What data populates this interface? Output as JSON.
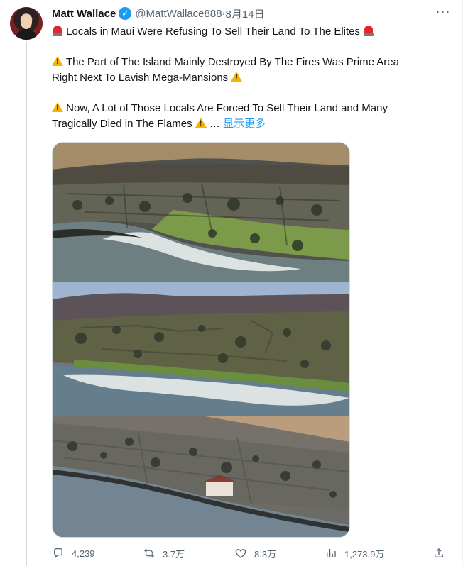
{
  "tweet": {
    "author_name": "Matt Wallace",
    "handle": "@MattWallace888",
    "separator": "·",
    "date": "8月14日",
    "more_label": "···",
    "text_lines": {
      "p1": "Locals in Maui Were Refusing To Sell Their Land To The Elites",
      "p2a": "The Part of The Island Mainly Destroyed By The Fires Was Prime Area",
      "p2b": "Right Next To Lavish Mega-Mansions",
      "p3a": "Now, A Lot of Those Locals Are Forced To Sell Their Land and Many",
      "p3b": "Tragically Died in The Flames",
      "ellipsis": " … ",
      "show_more": "显示更多"
    },
    "verified_mark": "✓",
    "icons": [
      "siren-emoji",
      "warning-emoji"
    ],
    "accent_color": "#1d9bf0"
  },
  "media": {
    "images": [
      "aerial-photo-burned-coastline-1",
      "aerial-photo-burned-coastline-2",
      "aerial-photo-burned-coastline-3"
    ]
  },
  "actions": {
    "reply_count": "4,239",
    "retweet_count": "3.7万",
    "like_count": "8.3万",
    "views_count": "1,273.9万",
    "icons": [
      "reply-icon",
      "retweet-icon",
      "like-icon",
      "views-icon",
      "share-icon"
    ]
  }
}
